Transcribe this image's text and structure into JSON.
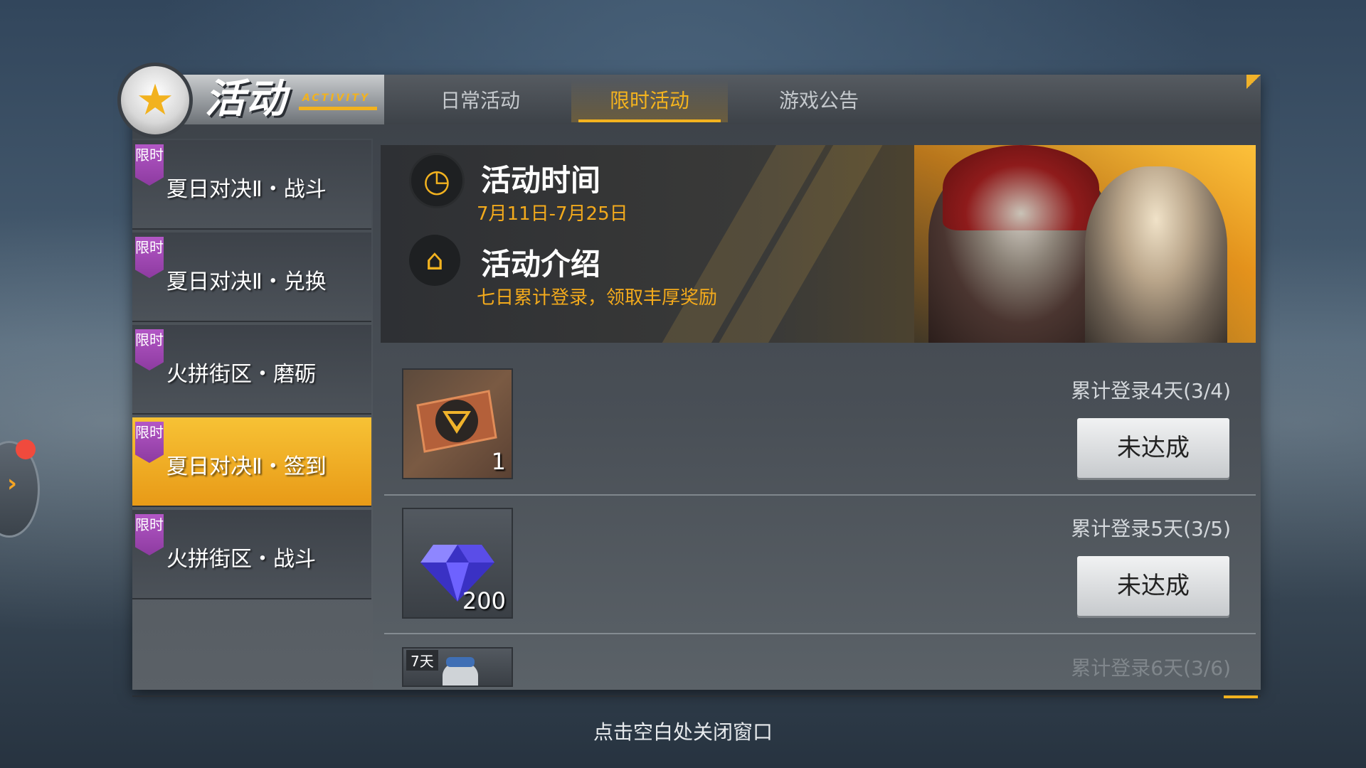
{
  "header": {
    "title": "活动",
    "subtitle": "ACTIVITY",
    "tabs": [
      {
        "label": "日常活动",
        "active": false
      },
      {
        "label": "限时活动",
        "active": true
      },
      {
        "label": "游戏公告",
        "active": false
      }
    ]
  },
  "sidebar": {
    "tag": "限时",
    "items": [
      {
        "label": "夏日对决Ⅱ・战斗",
        "active": false
      },
      {
        "label": "夏日对决Ⅱ・兑换",
        "active": false
      },
      {
        "label": "火拼街区・磨砺",
        "active": false
      },
      {
        "label": "夏日对决Ⅱ・签到",
        "active": true
      },
      {
        "label": "火拼街区・战斗",
        "active": false
      }
    ]
  },
  "banner": {
    "time_heading": "活动时间",
    "time_value": "7月11日-7月25日",
    "intro_heading": "活动介绍",
    "intro_value": "七日累计登录，领取丰厚奖励"
  },
  "rewards": [
    {
      "requirement": "累计登录4天(3/4)",
      "quantity": "1",
      "item_icon": "emblem-badge-icon",
      "status": "未达成"
    },
    {
      "requirement": "累计登录5天(3/5)",
      "quantity": "200",
      "item_icon": "diamond-icon",
      "status": "未达成"
    },
    {
      "requirement": "累计登录6天(3/6)",
      "duration": "7天",
      "item_icon": "cat-pet-icon"
    }
  ],
  "footer": {
    "close_hint": "点击空白处关闭窗口"
  },
  "colors": {
    "accent": "#f2b21f",
    "tag_purple": "#a24bb5",
    "active_item": "#f0ac25",
    "notification": "#f04a3d"
  }
}
